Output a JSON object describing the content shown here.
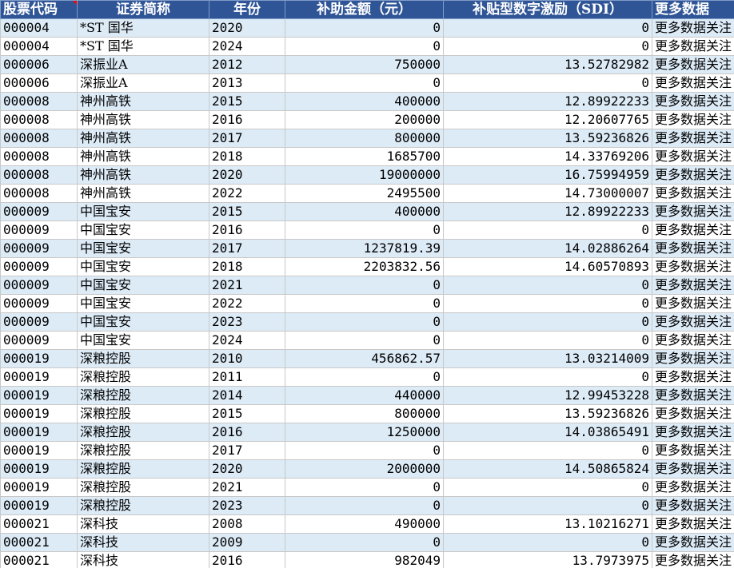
{
  "headers": {
    "code": "股票代码",
    "name": "证券简称",
    "year": "年份",
    "amount": "补助金额（元）",
    "sdi": "补贴型数字激励（SDI）",
    "more": "更多数据"
  },
  "rows": [
    {
      "code": "000004",
      "name": "*ST 国华",
      "year": "2020",
      "amount": "0",
      "sdi": "0",
      "more": "更多数据关注"
    },
    {
      "code": "000004",
      "name": "*ST 国华",
      "year": "2024",
      "amount": "0",
      "sdi": "0",
      "more": "更多数据关注"
    },
    {
      "code": "000006",
      "name": "深振业A",
      "year": "2012",
      "amount": "750000",
      "sdi": "13.52782982",
      "more": "更多数据关注"
    },
    {
      "code": "000006",
      "name": "深振业A",
      "year": "2013",
      "amount": "0",
      "sdi": "0",
      "more": "更多数据关注"
    },
    {
      "code": "000008",
      "name": "神州高铁",
      "year": "2015",
      "amount": "400000",
      "sdi": "12.89922233",
      "more": "更多数据关注"
    },
    {
      "code": "000008",
      "name": "神州高铁",
      "year": "2016",
      "amount": "200000",
      "sdi": "12.20607765",
      "more": "更多数据关注"
    },
    {
      "code": "000008",
      "name": "神州高铁",
      "year": "2017",
      "amount": "800000",
      "sdi": "13.59236826",
      "more": "更多数据关注"
    },
    {
      "code": "000008",
      "name": "神州高铁",
      "year": "2018",
      "amount": "1685700",
      "sdi": "14.33769206",
      "more": "更多数据关注"
    },
    {
      "code": "000008",
      "name": "神州高铁",
      "year": "2020",
      "amount": "19000000",
      "sdi": "16.75994959",
      "more": "更多数据关注"
    },
    {
      "code": "000008",
      "name": "神州高铁",
      "year": "2022",
      "amount": "2495500",
      "sdi": "14.73000007",
      "more": "更多数据关注"
    },
    {
      "code": "000009",
      "name": "中国宝安",
      "year": "2015",
      "amount": "400000",
      "sdi": "12.89922233",
      "more": "更多数据关注"
    },
    {
      "code": "000009",
      "name": "中国宝安",
      "year": "2016",
      "amount": "0",
      "sdi": "0",
      "more": "更多数据关注"
    },
    {
      "code": "000009",
      "name": "中国宝安",
      "year": "2017",
      "amount": "1237819.39",
      "sdi": "14.02886264",
      "more": "更多数据关注"
    },
    {
      "code": "000009",
      "name": "中国宝安",
      "year": "2018",
      "amount": "2203832.56",
      "sdi": "14.60570893",
      "more": "更多数据关注"
    },
    {
      "code": "000009",
      "name": "中国宝安",
      "year": "2021",
      "amount": "0",
      "sdi": "0",
      "more": "更多数据关注"
    },
    {
      "code": "000009",
      "name": "中国宝安",
      "year": "2022",
      "amount": "0",
      "sdi": "0",
      "more": "更多数据关注"
    },
    {
      "code": "000009",
      "name": "中国宝安",
      "year": "2023",
      "amount": "0",
      "sdi": "0",
      "more": "更多数据关注"
    },
    {
      "code": "000009",
      "name": "中国宝安",
      "year": "2024",
      "amount": "0",
      "sdi": "0",
      "more": "更多数据关注"
    },
    {
      "code": "000019",
      "name": "深粮控股",
      "year": "2010",
      "amount": "456862.57",
      "sdi": "13.03214009",
      "more": "更多数据关注"
    },
    {
      "code": "000019",
      "name": "深粮控股",
      "year": "2011",
      "amount": "0",
      "sdi": "0",
      "more": "更多数据关注"
    },
    {
      "code": "000019",
      "name": "深粮控股",
      "year": "2014",
      "amount": "440000",
      "sdi": "12.99453228",
      "more": "更多数据关注"
    },
    {
      "code": "000019",
      "name": "深粮控股",
      "year": "2015",
      "amount": "800000",
      "sdi": "13.59236826",
      "more": "更多数据关注"
    },
    {
      "code": "000019",
      "name": "深粮控股",
      "year": "2016",
      "amount": "1250000",
      "sdi": "14.03865491",
      "more": "更多数据关注"
    },
    {
      "code": "000019",
      "name": "深粮控股",
      "year": "2017",
      "amount": "0",
      "sdi": "0",
      "more": "更多数据关注"
    },
    {
      "code": "000019",
      "name": "深粮控股",
      "year": "2020",
      "amount": "2000000",
      "sdi": "14.50865824",
      "more": "更多数据关注"
    },
    {
      "code": "000019",
      "name": "深粮控股",
      "year": "2021",
      "amount": "0",
      "sdi": "0",
      "more": "更多数据关注"
    },
    {
      "code": "000019",
      "name": "深粮控股",
      "year": "2023",
      "amount": "0",
      "sdi": "0",
      "more": "更多数据关注"
    },
    {
      "code": "000021",
      "name": "深科技",
      "year": "2008",
      "amount": "490000",
      "sdi": "13.10216271",
      "more": "更多数据关注"
    },
    {
      "code": "000021",
      "name": "深科技",
      "year": "2009",
      "amount": "0",
      "sdi": "0",
      "more": "更多数据关注"
    },
    {
      "code": "000021",
      "name": "深科技",
      "year": "2016",
      "amount": "982049",
      "sdi": "13.7973975",
      "more": "更多数据关注"
    }
  ]
}
